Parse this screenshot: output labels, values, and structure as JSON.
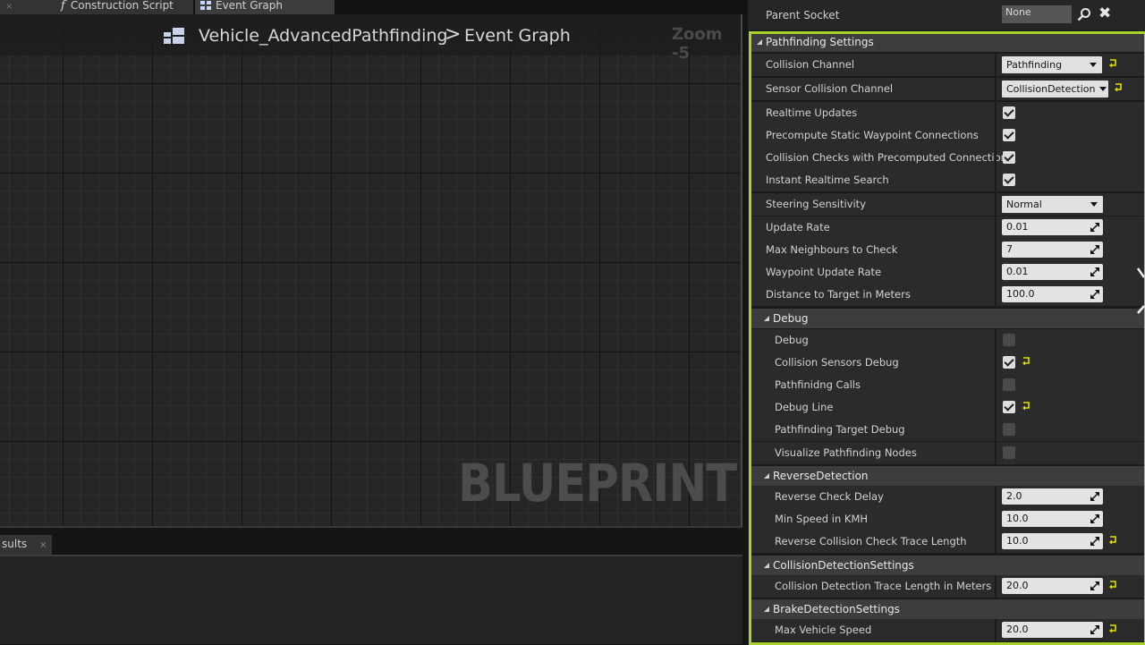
{
  "tabs": {
    "construction_script": "Construction Script",
    "event_graph": "Event Graph",
    "close_glyph": "×"
  },
  "graph": {
    "breadcrumb_blueprint": "Vehicle_AdvancedPathfinding",
    "breadcrumb_separator": ">",
    "breadcrumb_graph": "Event Graph",
    "zoom": "Zoom -5",
    "watermark": "BLUEPRINT"
  },
  "bottom": {
    "results_tab": "sults"
  },
  "details": {
    "parent_socket": {
      "label": "Parent Socket",
      "value": "None"
    },
    "pathfinding": {
      "header": "Pathfinding Settings",
      "collision_channel": {
        "label": "Collision Channel",
        "value": "Pathfinding"
      },
      "sensor_collision_channel": {
        "label": "Sensor Collision Channel",
        "value": "CollisionDetection"
      },
      "realtime_updates": {
        "label": "Realtime Updates"
      },
      "precompute_static": {
        "label": "Precompute Static Waypoint Connections"
      },
      "collision_checks_precomputed": {
        "label": "Collision Checks with Precomputed Connection"
      },
      "instant_realtime_search": {
        "label": "Instant Realtime Search"
      },
      "steering_sensitivity": {
        "label": "Steering Sensitivity",
        "value": "Normal"
      },
      "update_rate": {
        "label": "Update Rate",
        "value": "0.01"
      },
      "max_neighbours": {
        "label": "Max Neighbours to Check",
        "value": "7"
      },
      "waypoint_update_rate": {
        "label": "Waypoint Update Rate",
        "value": "0.01"
      },
      "distance_to_target": {
        "label": "Distance to Target in Meters",
        "value": "100.0"
      }
    },
    "debug": {
      "header": "Debug",
      "debug": {
        "label": "Debug"
      },
      "collision_sensors_debug": {
        "label": "Collision Sensors Debug"
      },
      "pathfinding_calls": {
        "label": "Pathfinidng Calls"
      },
      "debug_line": {
        "label": "Debug Line"
      },
      "pathfinding_target_debug": {
        "label": "Pathfinding Target Debug"
      },
      "visualize_nodes": {
        "label": "Visualize Pathfinding Nodes"
      }
    },
    "reverse": {
      "header": "ReverseDetection",
      "reverse_check_delay": {
        "label": "Reverse Check Delay",
        "value": "2.0"
      },
      "min_speed": {
        "label": "Min Speed in KMH",
        "value": "10.0"
      },
      "reverse_trace_length": {
        "label": "Reverse Collision Check Trace Length",
        "value": "10.0"
      }
    },
    "collision_detection": {
      "header": "CollisionDetectionSettings",
      "trace_length": {
        "label": "Collision Detection Trace Length in Meters",
        "value": "20.0"
      }
    },
    "brake_detection": {
      "header": "BrakeDetectionSettings",
      "max_vehicle_speed": {
        "label": "Max Vehicle Speed",
        "value": "20.0"
      }
    }
  },
  "colors": {
    "highlight_border": "#a9d12d",
    "reset_arrow": "#e3e000",
    "panel_bg": "#1b1b1b",
    "row_bg": "#2b2b2b",
    "category_bg": "#3d3d3d"
  }
}
